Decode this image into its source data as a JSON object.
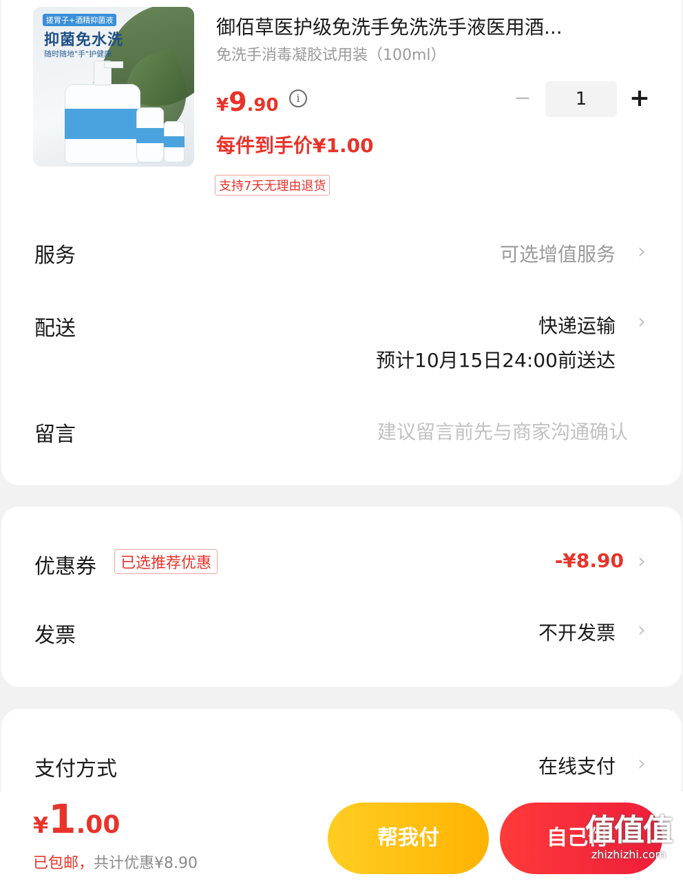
{
  "product": {
    "image_texts": {
      "badge": "搓胃子+酒精抑菌液",
      "headline": "抑菌免水洗",
      "sub": "随时随地\"手\"护健康"
    },
    "title": "御佰草医护级免洗手免洗洗手液医用酒...",
    "spec": "免洗手消毒凝胶试用装（100ml）",
    "price_currency": "¥",
    "price_int": "9",
    "price_dec": ".90",
    "deal_price": "每件到手价¥1.00",
    "return_tag": "支持7天无理由退货",
    "quantity": "1",
    "minus": "−",
    "plus": "+"
  },
  "rows": {
    "service": {
      "label": "服务",
      "value": "可选增值服务"
    },
    "delivery": {
      "label": "配送",
      "value": "快递运输",
      "eta": "预计10月15日24:00前送达"
    },
    "message": {
      "label": "留言",
      "placeholder": "建议留言前先与商家沟通确认"
    },
    "coupon": {
      "label": "优惠券",
      "tag": "已选推荐优惠",
      "value": "-¥8.90"
    },
    "invoice": {
      "label": "发票",
      "value": "不开发票"
    },
    "payment": {
      "label": "支付方式",
      "value": "在线支付"
    }
  },
  "chevron": "›",
  "bottom": {
    "total_currency": "¥",
    "total_int": "1",
    "total_dec": ".00",
    "shipping": "已包邮，",
    "discount": "共计优惠¥8.90",
    "help_pay": "帮我付",
    "self_pay": "自己付"
  },
  "watermark": {
    "main": "值值值",
    "sub": "zhizhizhi.com"
  },
  "colors": {
    "accent_red": "#e8332a",
    "help_yellow": "#ffc107",
    "pay_red": "#f0283a"
  }
}
